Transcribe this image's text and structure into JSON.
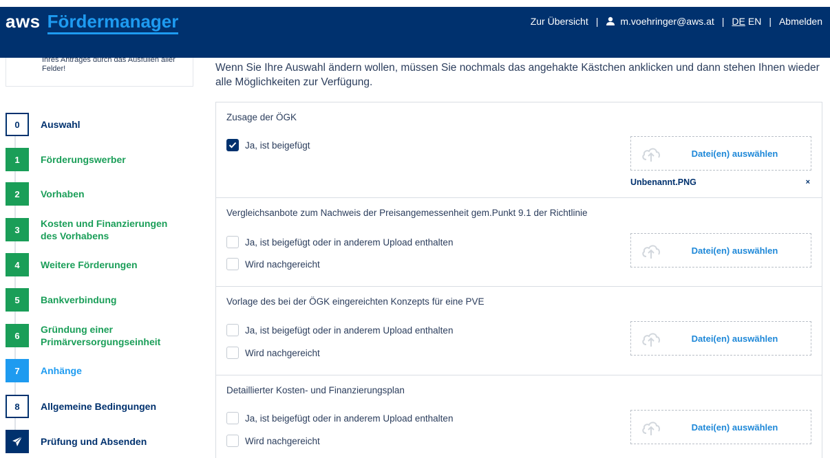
{
  "header": {
    "brand_short": "aws",
    "brand_name": "Fördermanager",
    "overview_link": "Zur Übersicht",
    "user_email": "m.voehringer@aws.at",
    "lang_de": "DE",
    "lang_en": "EN",
    "logout": "Abmelden",
    "separator": "|"
  },
  "sidebar": {
    "info_text": "Ihres Antrages durch das Ausfüllen aller Felder!",
    "steps": [
      {
        "badge": "0",
        "label": "Auswahl"
      },
      {
        "badge": "1",
        "label": "Förderungswerber"
      },
      {
        "badge": "2",
        "label": "Vorhaben"
      },
      {
        "badge": "3",
        "label": "Kosten und Finanzierungen des Vorhabens"
      },
      {
        "badge": "4",
        "label": "Weitere Förderungen"
      },
      {
        "badge": "5",
        "label": "Bankverbindung"
      },
      {
        "badge": "6",
        "label": "Gründung einer Primärversorgungseinheit"
      },
      {
        "badge": "7",
        "label": "Anhänge"
      },
      {
        "badge": "8",
        "label": "Allgemeine Bedingungen"
      },
      {
        "badge": "send-icon",
        "label": "Prüfung und Absenden"
      }
    ]
  },
  "main": {
    "intro": "Wenn Sie Ihre Auswahl ändern wollen, müssen Sie nochmals das angehakte Kästchen anklicken und dann stehen Ihnen wieder alle Möglichkeiten zur Verfügung.",
    "upload_label": "Datei(en) auswählen",
    "sections": [
      {
        "title": "Zusage der ÖGK",
        "options": [
          {
            "label": "Ja, ist beigefügt",
            "checked": true
          }
        ],
        "file": {
          "name": "Unbenannt.PNG",
          "remove": "×"
        }
      },
      {
        "title": "Vergleichsanbote zum Nachweis der Preisangemessenheit gem.Punkt 9.1 der Richtlinie",
        "options": [
          {
            "label": "Ja, ist beigefügt oder in anderem Upload enthalten",
            "checked": false
          },
          {
            "label": "Wird nachgereicht",
            "checked": false
          }
        ]
      },
      {
        "title": "Vorlage des bei der ÖGK eingereichten Konzepts für eine PVE",
        "options": [
          {
            "label": "Ja, ist beigefügt oder in anderem Upload enthalten",
            "checked": false
          },
          {
            "label": "Wird nachgereicht",
            "checked": false
          }
        ]
      },
      {
        "title": "Detaillierter Kosten- und Finanzierungsplan",
        "options": [
          {
            "label": "Ja, ist beigefügt oder in anderem Upload enthalten",
            "checked": false
          },
          {
            "label": "Wird nachgereicht",
            "checked": false
          }
        ]
      }
    ]
  },
  "colors": {
    "header_bg": "#00316e",
    "accent_blue": "#1e9bf0",
    "step_green": "#1a9e58"
  }
}
